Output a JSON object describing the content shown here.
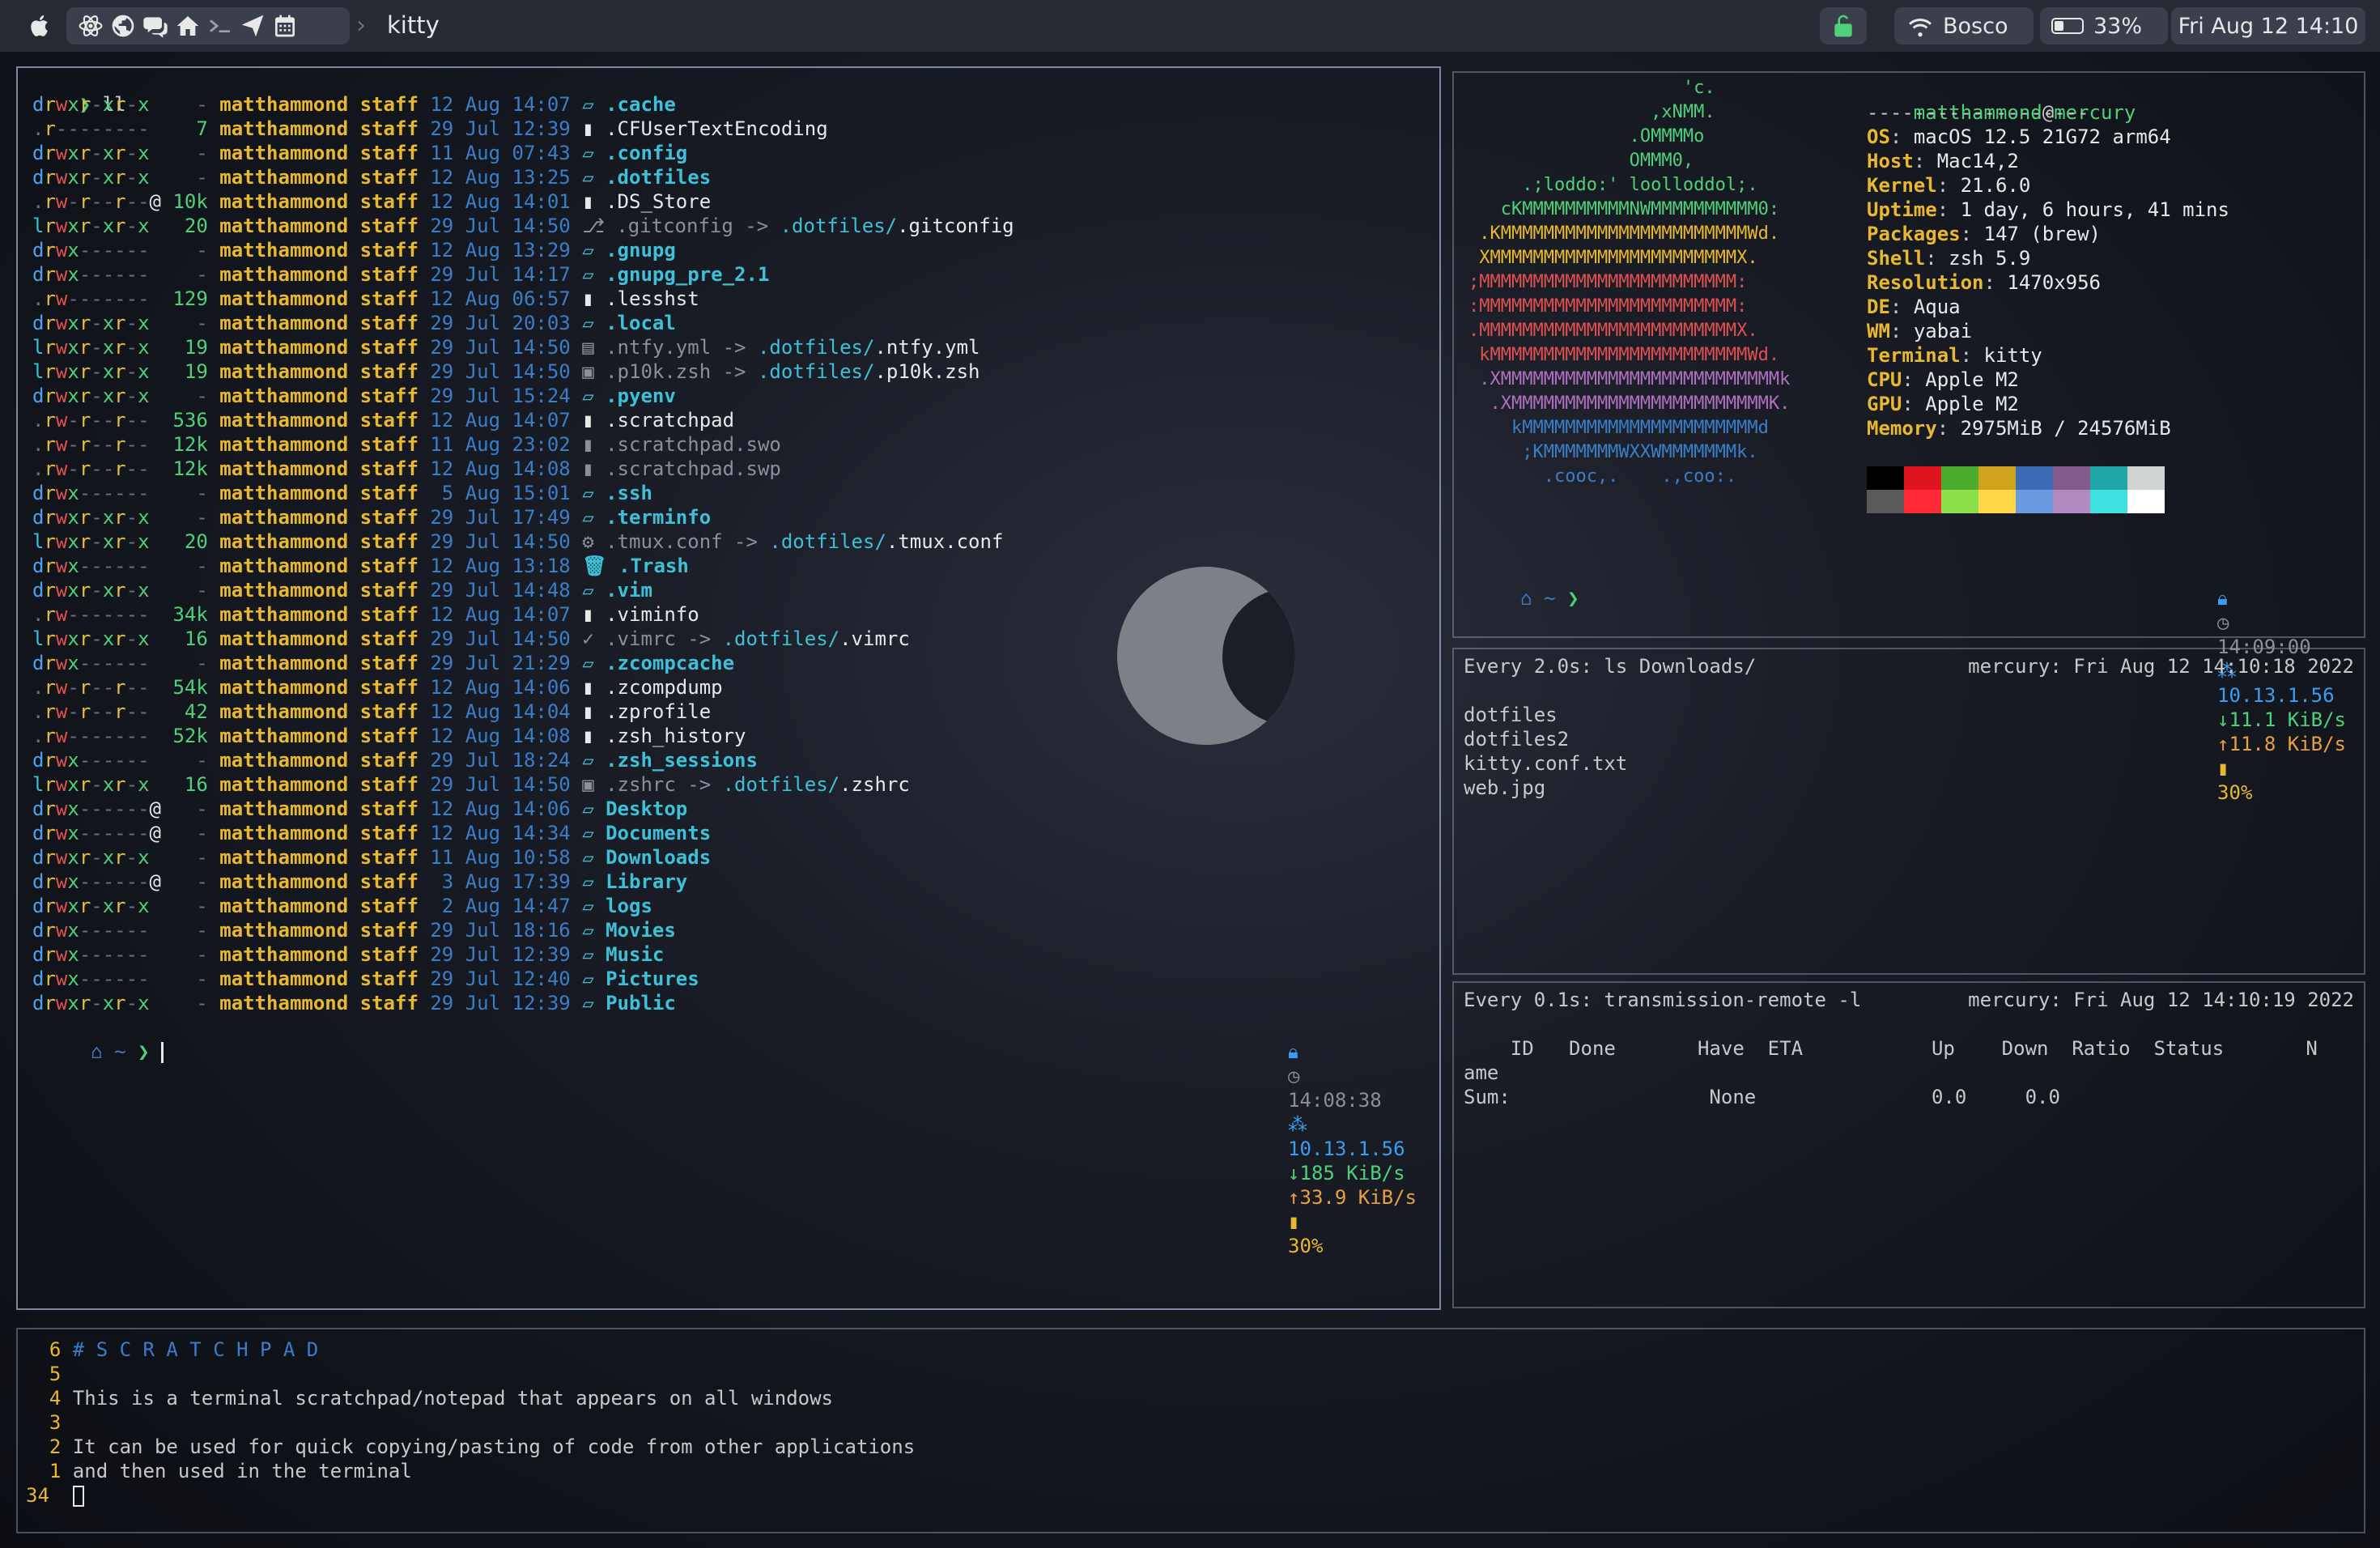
{
  "menubar": {
    "app_title": "kitty",
    "vpn": "",
    "wifi": "Bosco",
    "battery": "33%",
    "datetime": "Fri Aug 12 14:10",
    "icons": [
      "apple-icon",
      "react-icon",
      "globe-icon",
      "chat-icon",
      "home-icon",
      "terminal-icon",
      "send-icon",
      "calendar-icon"
    ]
  },
  "main": {
    "prompt": "❯ ll",
    "rows": [
      {
        "perm": "drwxr-xr-x",
        "size": "-",
        "user": "matthammond",
        "group": "staff",
        "day": "12",
        "mon": "Aug",
        "time": "14:07",
        "icon": "folder",
        "name": ".cache",
        "kind": "dir"
      },
      {
        "perm": ".r--------",
        "size": "7",
        "user": "matthammond",
        "group": "staff",
        "day": "29",
        "mon": "Jul",
        "time": "12:39",
        "icon": "file",
        "name": ".CFUserTextEncoding",
        "kind": "file"
      },
      {
        "perm": "drwxr-xr-x",
        "size": "-",
        "user": "matthammond",
        "group": "staff",
        "day": "11",
        "mon": "Aug",
        "time": "07:43",
        "icon": "folder",
        "name": ".config",
        "kind": "dir"
      },
      {
        "perm": "drwxr-xr-x",
        "size": "-",
        "user": "matthammond",
        "group": "staff",
        "day": "12",
        "mon": "Aug",
        "time": "13:25",
        "icon": "folder",
        "name": ".dotfiles",
        "kind": "dir"
      },
      {
        "perm": ".rw-r--r--@",
        "size": "10k",
        "user": "matthammond",
        "group": "staff",
        "day": "12",
        "mon": "Aug",
        "time": "14:01",
        "icon": "apple",
        "name": ".DS_Store",
        "kind": "file"
      },
      {
        "perm": "lrwxr-xr-x",
        "size": "20",
        "user": "matthammond",
        "group": "staff",
        "day": "29",
        "mon": "Jul",
        "time": "14:50",
        "icon": "git",
        "name": ".gitconfig",
        "kind": "link",
        "target_dir": ".dotfiles/",
        "target_file": ".gitconfig"
      },
      {
        "perm": "drwx------",
        "size": "-",
        "user": "matthammond",
        "group": "staff",
        "day": "12",
        "mon": "Aug",
        "time": "13:29",
        "icon": "folder",
        "name": ".gnupg",
        "kind": "dir"
      },
      {
        "perm": "drwx------",
        "size": "-",
        "user": "matthammond",
        "group": "staff",
        "day": "29",
        "mon": "Jul",
        "time": "14:17",
        "icon": "folder",
        "name": ".gnupg_pre_2.1",
        "kind": "dir"
      },
      {
        "perm": ".rw-------",
        "size": "129",
        "user": "matthammond",
        "group": "staff",
        "day": "12",
        "mon": "Aug",
        "time": "06:57",
        "icon": "file",
        "name": ".lesshst",
        "kind": "file"
      },
      {
        "perm": "drwxr-xr-x",
        "size": "-",
        "user": "matthammond",
        "group": "staff",
        "day": "29",
        "mon": "Jul",
        "time": "20:03",
        "icon": "folder",
        "name": ".local",
        "kind": "dir"
      },
      {
        "perm": "lrwxr-xr-x",
        "size": "19",
        "user": "matthammond",
        "group": "staff",
        "day": "29",
        "mon": "Jul",
        "time": "14:50",
        "icon": "doc",
        "name": ".ntfy.yml",
        "kind": "link",
        "target_dir": ".dotfiles/",
        "target_file": ".ntfy.yml"
      },
      {
        "perm": "lrwxr-xr-x",
        "size": "19",
        "user": "matthammond",
        "group": "staff",
        "day": "29",
        "mon": "Jul",
        "time": "14:50",
        "icon": "term",
        "name": ".p10k.zsh",
        "kind": "link",
        "target_dir": ".dotfiles/",
        "target_file": ".p10k.zsh"
      },
      {
        "perm": "drwxr-xr-x",
        "size": "-",
        "user": "matthammond",
        "group": "staff",
        "day": "29",
        "mon": "Jul",
        "time": "15:24",
        "icon": "folder",
        "name": ".pyenv",
        "kind": "dir"
      },
      {
        "perm": ".rw-r--r--",
        "size": "536",
        "user": "matthammond",
        "group": "staff",
        "day": "12",
        "mon": "Aug",
        "time": "14:07",
        "icon": "file",
        "name": ".scratchpad",
        "kind": "file"
      },
      {
        "perm": ".rw-r--r--",
        "size": "12k",
        "user": "matthammond",
        "group": "staff",
        "day": "11",
        "mon": "Aug",
        "time": "23:02",
        "icon": "file",
        "name": ".scratchpad.swo",
        "kind": "dim"
      },
      {
        "perm": ".rw-r--r--",
        "size": "12k",
        "user": "matthammond",
        "group": "staff",
        "day": "12",
        "mon": "Aug",
        "time": "14:08",
        "icon": "file",
        "name": ".scratchpad.swp",
        "kind": "dim"
      },
      {
        "perm": "drwx------",
        "size": "-",
        "user": "matthammond",
        "group": "staff",
        "day": "5",
        "mon": "Aug",
        "time": "15:01",
        "icon": "folder",
        "name": ".ssh",
        "kind": "dir"
      },
      {
        "perm": "drwxr-xr-x",
        "size": "-",
        "user": "matthammond",
        "group": "staff",
        "day": "29",
        "mon": "Jul",
        "time": "17:49",
        "icon": "folder",
        "name": ".terminfo",
        "kind": "dir"
      },
      {
        "perm": "lrwxr-xr-x",
        "size": "20",
        "user": "matthammond",
        "group": "staff",
        "day": "29",
        "mon": "Jul",
        "time": "14:50",
        "icon": "gear",
        "name": ".tmux.conf",
        "kind": "link",
        "target_dir": ".dotfiles/",
        "target_file": ".tmux.conf"
      },
      {
        "perm": "drwx------",
        "size": "-",
        "user": "matthammond",
        "group": "staff",
        "day": "12",
        "mon": "Aug",
        "time": "13:18",
        "icon": "trash",
        "name": ".Trash",
        "kind": "dir"
      },
      {
        "perm": "drwxr-xr-x",
        "size": "-",
        "user": "matthammond",
        "group": "staff",
        "day": "29",
        "mon": "Jul",
        "time": "14:48",
        "icon": "folder",
        "name": ".vim",
        "kind": "dir"
      },
      {
        "perm": ".rw-------",
        "size": "34k",
        "user": "matthammond",
        "group": "staff",
        "day": "12",
        "mon": "Aug",
        "time": "14:07",
        "icon": "file",
        "name": ".viminfo",
        "kind": "file"
      },
      {
        "perm": "lrwxr-xr-x",
        "size": "16",
        "user": "matthammond",
        "group": "staff",
        "day": "29",
        "mon": "Jul",
        "time": "14:50",
        "icon": "vim",
        "name": ".vimrc",
        "kind": "link",
        "target_dir": ".dotfiles/",
        "target_file": ".vimrc"
      },
      {
        "perm": "drwx------",
        "size": "-",
        "user": "matthammond",
        "group": "staff",
        "day": "29",
        "mon": "Jul",
        "time": "21:29",
        "icon": "folder",
        "name": ".zcompcache",
        "kind": "dir"
      },
      {
        "perm": ".rw-r--r--",
        "size": "54k",
        "user": "matthammond",
        "group": "staff",
        "day": "12",
        "mon": "Aug",
        "time": "14:06",
        "icon": "file",
        "name": ".zcompdump",
        "kind": "file"
      },
      {
        "perm": ".rw-r--r--",
        "size": "42",
        "user": "matthammond",
        "group": "staff",
        "day": "12",
        "mon": "Aug",
        "time": "14:04",
        "icon": "file",
        "name": ".zprofile",
        "kind": "file"
      },
      {
        "perm": ".rw-------",
        "size": "52k",
        "user": "matthammond",
        "group": "staff",
        "day": "12",
        "mon": "Aug",
        "time": "14:08",
        "icon": "file",
        "name": ".zsh_history",
        "kind": "file"
      },
      {
        "perm": "drwx------",
        "size": "-",
        "user": "matthammond",
        "group": "staff",
        "day": "29",
        "mon": "Jul",
        "time": "18:24",
        "icon": "folder",
        "name": ".zsh_sessions",
        "kind": "dir"
      },
      {
        "perm": "lrwxr-xr-x",
        "size": "16",
        "user": "matthammond",
        "group": "staff",
        "day": "29",
        "mon": "Jul",
        "time": "14:50",
        "icon": "term",
        "name": ".zshrc",
        "kind": "link",
        "target_dir": ".dotfiles/",
        "target_file": ".zshrc"
      },
      {
        "perm": "drwx------@",
        "size": "-",
        "user": "matthammond",
        "group": "staff",
        "day": "12",
        "mon": "Aug",
        "time": "14:06",
        "icon": "folder",
        "name": "Desktop",
        "kind": "dir"
      },
      {
        "perm": "drwx------@",
        "size": "-",
        "user": "matthammond",
        "group": "staff",
        "day": "12",
        "mon": "Aug",
        "time": "14:34",
        "icon": "folder",
        "name": "Documents",
        "kind": "dir"
      },
      {
        "perm": "drwxr-xr-x",
        "size": "-",
        "user": "matthammond",
        "group": "staff",
        "day": "11",
        "mon": "Aug",
        "time": "10:58",
        "icon": "folder",
        "name": "Downloads",
        "kind": "dir"
      },
      {
        "perm": "drwx------@",
        "size": "-",
        "user": "matthammond",
        "group": "staff",
        "day": "3",
        "mon": "Aug",
        "time": "17:39",
        "icon": "folder",
        "name": "Library",
        "kind": "dir"
      },
      {
        "perm": "drwxr-xr-x",
        "size": "-",
        "user": "matthammond",
        "group": "staff",
        "day": "2",
        "mon": "Aug",
        "time": "14:47",
        "icon": "folder",
        "name": "logs",
        "kind": "dir"
      },
      {
        "perm": "drwx------",
        "size": "-",
        "user": "matthammond",
        "group": "staff",
        "day": "29",
        "mon": "Jul",
        "time": "18:16",
        "icon": "folder",
        "name": "Movies",
        "kind": "dir"
      },
      {
        "perm": "drwx------",
        "size": "-",
        "user": "matthammond",
        "group": "staff",
        "day": "29",
        "mon": "Jul",
        "time": "12:39",
        "icon": "folder",
        "name": "Music",
        "kind": "dir"
      },
      {
        "perm": "drwx------",
        "size": "-",
        "user": "matthammond",
        "group": "staff",
        "day": "29",
        "mon": "Jul",
        "time": "12:40",
        "icon": "folder",
        "name": "Pictures",
        "kind": "dir"
      },
      {
        "perm": "drwxr-xr-x",
        "size": "-",
        "user": "matthammond",
        "group": "staff",
        "day": "29",
        "mon": "Jul",
        "time": "12:39",
        "icon": "folder",
        "name": "Public",
        "kind": "dir"
      }
    ],
    "status": {
      "prompt_symbol": "❯",
      "time": "14:08:38",
      "ip": "10.13.1.56",
      "down": "↓185 KiB/s",
      "up": "↑33.9 KiB/s",
      "battery": "30%"
    }
  },
  "fetch": {
    "user": "matthammond",
    "at": "@",
    "host": "mercury",
    "divider": "-------------------",
    "info": [
      {
        "key": "OS",
        "value": "macOS 12.5 21G72 arm64"
      },
      {
        "key": "Host",
        "value": "Mac14,2"
      },
      {
        "key": "Kernel",
        "value": "21.6.0"
      },
      {
        "key": "Uptime",
        "value": "1 day, 6 hours, 41 mins"
      },
      {
        "key": "Packages",
        "value": "147 (brew)"
      },
      {
        "key": "Shell",
        "value": "zsh 5.9"
      },
      {
        "key": "Resolution",
        "value": "1470x956"
      },
      {
        "key": "DE",
        "value": "Aqua"
      },
      {
        "key": "WM",
        "value": "yabai"
      },
      {
        "key": "Terminal",
        "value": "kitty"
      },
      {
        "key": "CPU",
        "value": "Apple M2"
      },
      {
        "key": "GPU",
        "value": "Apple M2"
      },
      {
        "key": "Memory",
        "value": "2975MiB / 24576MiB"
      }
    ],
    "logo": [
      {
        "text": "                    'c.",
        "color": "#4fd07a"
      },
      {
        "text": "                 ,xNMM.",
        "color": "#4fd07a"
      },
      {
        "text": "               .OMMMMo",
        "color": "#4fd07a"
      },
      {
        "text": "               OMMM0,",
        "color": "#4fd07a"
      },
      {
        "text": "     .;loddo:' loolloddol;.",
        "color": "#4fd07a"
      },
      {
        "text": "   cKMMMMMMMMMMNWMMMMMMMMMM0:",
        "color": "#4fd07a"
      },
      {
        "text": " .KMMMMMMMMMMMMMMMMMMMMMMMWd.",
        "color": "#e8b830"
      },
      {
        "text": " XMMMMMMMMMMMMMMMMMMMMMMMX.",
        "color": "#e8b830"
      },
      {
        "text": ";MMMMMMMMMMMMMMMMMMMMMMMM:",
        "color": "#e05050"
      },
      {
        "text": ":MMMMMMMMMMMMMMMMMMMMMMMM:",
        "color": "#e05050"
      },
      {
        "text": ".MMMMMMMMMMMMMMMMMMMMMMMMX.",
        "color": "#e05050"
      },
      {
        "text": " kMMMMMMMMMMMMMMMMMMMMMMMMWd.",
        "color": "#e05050"
      },
      {
        "text": " .XMMMMMMMMMMMMMMMMMMMMMMMMMMk",
        "color": "#b06fc0"
      },
      {
        "text": "  .XMMMMMMMMMMMMMMMMMMMMMMMMK.",
        "color": "#b06fc0"
      },
      {
        "text": "    kMMMMMMMMMMMMMMMMMMMMMMd",
        "color": "#3a7ec8"
      },
      {
        "text": "     ;KMMMMMMMWXXWMMMMMMMk.",
        "color": "#3a7ec8"
      },
      {
        "text": "       .cooc,.    .,coo:.",
        "color": "#3a7ec8"
      }
    ],
    "colors_top": [
      "#000000",
      "#e0141e",
      "#4cad2c",
      "#d1a31c",
      "#3b6bb4",
      "#825a8c",
      "#1fa6a6",
      "#d0d4d0"
    ],
    "colors_bottom": [
      "#5a5a5a",
      "#ff2a36",
      "#8ce04a",
      "#ffd84a",
      "#6a9ae0",
      "#b08ac0",
      "#3ee0e0",
      "#ffffff"
    ],
    "status": {
      "time": "14:09:00",
      "ip": "10.13.1.56",
      "down": "↓11.1 KiB/s",
      "up": "↑11.8 KiB/s",
      "battery": "30%"
    }
  },
  "watch1": {
    "header_left": "Every 2.0s: ls Downloads/",
    "header_right": "mercury: Fri Aug 12 14:10:18 2022",
    "lines": [
      "dotfiles",
      "dotfiles2",
      "kitty.conf.txt",
      "web.jpg"
    ]
  },
  "watch2": {
    "header_left": "Every 0.1s: transmission-remote -l",
    "header_right": "mercury: Fri Aug 12 14:10:19 2022",
    "columns": "    ID   Done       Have  ETA           Up    Down  Ratio  Status       N",
    "line2": "ame",
    "line3": "Sum:                 None               0.0     0.0"
  },
  "scratch": {
    "lines": [
      {
        "num": "6",
        "text": "# S C R A T C H P A D",
        "kind": "comment"
      },
      {
        "num": "5",
        "text": "",
        "kind": "text"
      },
      {
        "num": "4",
        "text": "This is a terminal scratchpad/notepad that appears on all windows",
        "kind": "text"
      },
      {
        "num": "3",
        "text": "",
        "kind": "text"
      },
      {
        "num": "2",
        "text": "It can be used for quick copying/pasting of code from other applications",
        "kind": "text"
      },
      {
        "num": "1",
        "text": "and then used in the terminal",
        "kind": "text"
      }
    ],
    "current_line": "34"
  }
}
